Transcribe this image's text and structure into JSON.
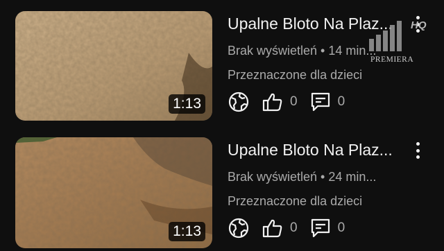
{
  "videos": [
    {
      "title": "Upalne Bloto Na Plaz...",
      "meta": "Brak wyświetleń • 14 min...",
      "audience": "Przeznaczone dla dzieci",
      "duration": "1:13",
      "likes": "0",
      "comments": "0",
      "thumbnail_colors": [
        "#c9ad87",
        "#a58560"
      ]
    },
    {
      "title": "Upalne Bloto Na Plaz...",
      "meta": "Brak wyświetleń • 24 min...",
      "audience": "Przeznaczone dla dzieci",
      "duration": "1:13",
      "likes": "0",
      "comments": "0",
      "thumbnail_colors": [
        "#b0875e",
        "#8a6a44"
      ]
    }
  ],
  "icons": {
    "visibility": "globe-icon",
    "like": "thumbs-up-icon",
    "comment": "comment-icon",
    "menu": "more-vert-icon"
  },
  "watermark": {
    "badge": "HQ",
    "label": "PREMIERA"
  }
}
